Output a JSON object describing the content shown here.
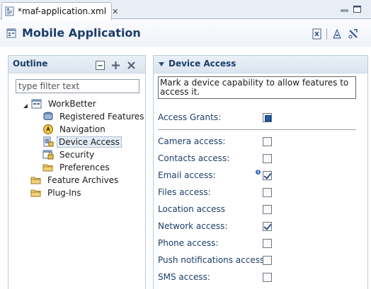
{
  "editor": {
    "tab_label": "*maf-application.xml",
    "tab_close": "✕"
  },
  "header": {
    "title": "Mobile Application"
  },
  "outline": {
    "title": "Outline",
    "filter_placeholder": "type filter text",
    "tree": {
      "root": "WorkBetter",
      "children": [
        "Registered Features",
        "Navigation",
        "Device Access",
        "Security",
        "Preferences"
      ],
      "siblings": [
        "Feature Archives",
        "Plug-Ins"
      ]
    },
    "selected": "Device Access"
  },
  "device_access": {
    "section_title": "Device Access",
    "description": "Mark a device capability to allow features to access it.",
    "access_grants_label": "Access Grants:",
    "access_grants_state": "indeterminate",
    "rows": [
      {
        "label": "Camera access:",
        "checked": false
      },
      {
        "label": "Contacts access:",
        "checked": false
      },
      {
        "label": "Email access:",
        "checked": true,
        "info": true
      },
      {
        "label": "Files access:",
        "checked": false
      },
      {
        "label": "Location access",
        "checked": false
      },
      {
        "label": "Network access:",
        "checked": true
      },
      {
        "label": "Phone access:",
        "checked": false
      },
      {
        "label": "Push notifications access:",
        "checked": false
      },
      {
        "label": "SMS access:",
        "checked": false
      }
    ]
  },
  "colors": {
    "header_text": "#1b3d6b",
    "panel_header_bg": "#dbe4ef",
    "tab_strip_bg": "#e8eef5",
    "check_color": "#2b4f8c"
  }
}
